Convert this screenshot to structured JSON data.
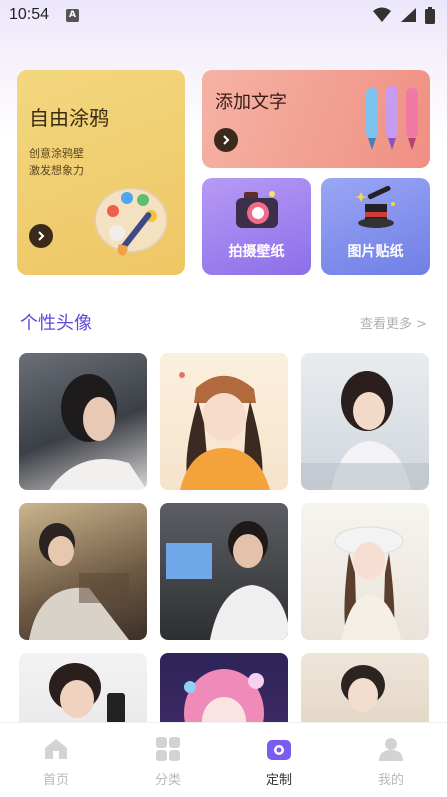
{
  "status_bar": {
    "time": "10:54",
    "app_icon_letter": "A"
  },
  "features": {
    "doodle": {
      "title": "自由涂鸦",
      "subtitle_line1": "创意涂鸦壁",
      "subtitle_line2": "激发想象力"
    },
    "add_text": {
      "title": "添加文字"
    },
    "photo_wallpaper": {
      "label": "拍摄壁纸"
    },
    "image_sticker": {
      "label": "图片贴纸"
    }
  },
  "avatars_section": {
    "title": "个性头像",
    "more": "查看更多 >"
  },
  "tabbar": {
    "home": "首页",
    "category": "分类",
    "custom": "定制",
    "mine": "我的"
  },
  "colors": {
    "accent": "#7b5cf0",
    "section_title": "#5f49d8"
  }
}
